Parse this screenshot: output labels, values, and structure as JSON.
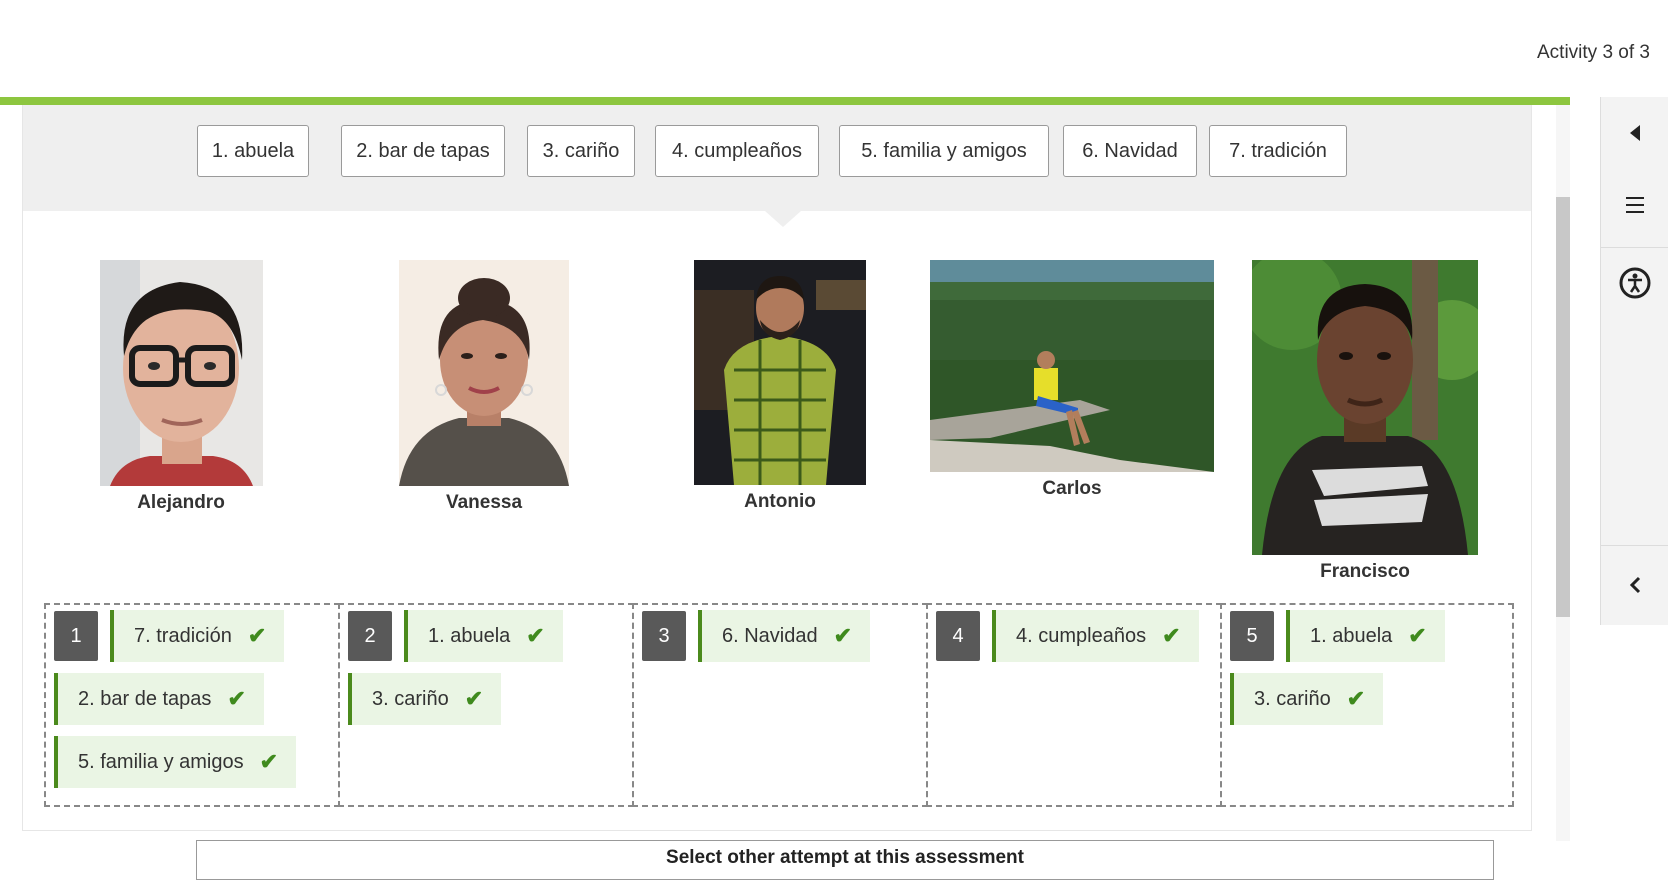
{
  "header": {
    "activity_counter": "Activity 3 of 3"
  },
  "word_bank": {
    "items": [
      "1. abuela",
      "2. bar de tapas",
      "3. cariño",
      "4. cumpleaños",
      "5. familia y amigos",
      "6. Navidad",
      "7. tradición"
    ]
  },
  "people": [
    {
      "name": "Alejandro"
    },
    {
      "name": "Vanessa"
    },
    {
      "name": "Antonio"
    },
    {
      "name": "Carlos"
    },
    {
      "name": "Francisco"
    }
  ],
  "drop_zones": [
    {
      "number": "1",
      "answers": [
        "7. tradición",
        "2. bar de tapas",
        "5. familia y amigos"
      ]
    },
    {
      "number": "2",
      "answers": [
        "1. abuela",
        "3. cariño"
      ]
    },
    {
      "number": "3",
      "answers": [
        "6. Navidad"
      ]
    },
    {
      "number": "4",
      "answers": [
        "4. cumpleaños"
      ]
    },
    {
      "number": "5",
      "answers": [
        "1. abuela",
        "3. cariño"
      ]
    }
  ],
  "footer": {
    "attempt_label": "Select other attempt at this assessment"
  },
  "colors": {
    "accent": "#8dc63f",
    "correct_chip": "#eaf5e4",
    "correct_border": "#4b8a1c",
    "zone_number": "#595959"
  },
  "side_panel": {
    "icons": [
      "triangle-left-icon",
      "menu-icon",
      "accessibility-icon",
      "chevron-left-icon"
    ]
  }
}
